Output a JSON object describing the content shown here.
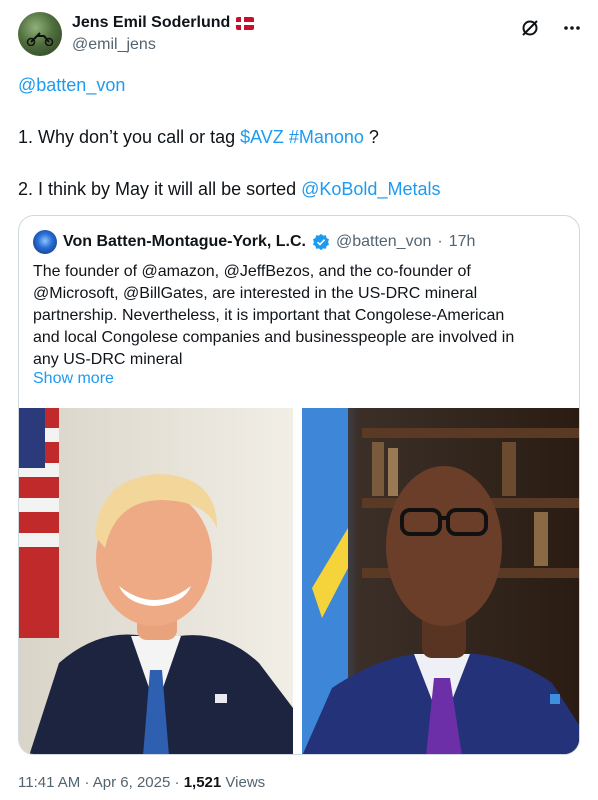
{
  "author": {
    "display_name": "Jens Emil Soderlund",
    "flag": "danish-flag-icon",
    "handle": "@emil_jens"
  },
  "actions": {
    "grok_icon": "slashed-circle-icon",
    "more_icon": "more-horizontal-icon",
    "more_label": "•••"
  },
  "tweet": {
    "mention": "@batten_von",
    "line2_prefix": "1. Why don’t you call or tag ",
    "cashtag": "$AVZ",
    "hashtag": "#Manono",
    "line2_suffix": " ?",
    "line3_prefix": "2. I think by May it will all be sorted ",
    "mention2": "@KoBold_Metals"
  },
  "quote": {
    "display_name": "Von Batten-Montague-York, L.C.",
    "handle": "@batten_von",
    "separator": "·",
    "time": "17h",
    "lines": [
      "The founder of @amazon, @JeffBezos, and the co-founder of",
      "@Microsoft, @BillGates, are interested in the US-DRC mineral",
      "partnership. Nevertheless, it is important that Congolese-American",
      "and local Congolese companies and businesspeople are involved in",
      "any US-DRC mineral"
    ],
    "show_more": "Show more"
  },
  "meta": {
    "time": "11:41 AM",
    "separator": "·",
    "date": "Apr 6, 2025",
    "views_count": "1,521",
    "views_label": "Views"
  },
  "colors": {
    "link": "#1d9bf0",
    "text": "#0f1419",
    "muted": "#536471",
    "border": "#cfd9de"
  }
}
